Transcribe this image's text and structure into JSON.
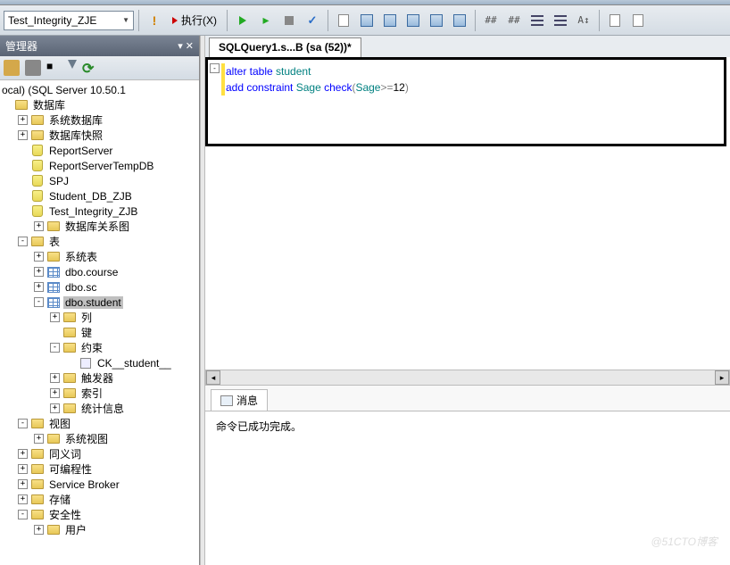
{
  "toolbar": {
    "db_selected": "Test_Integrity_ZJE",
    "execute_label": "执行(X)"
  },
  "sidebar": {
    "title": "管理器",
    "server": "ocal) (SQL Server 10.50.1",
    "nodes": [
      {
        "ind": 0,
        "exp": "",
        "icon": "folder",
        "label": "数据库"
      },
      {
        "ind": 1,
        "exp": "+",
        "icon": "folder",
        "label": "系统数据库"
      },
      {
        "ind": 1,
        "exp": "+",
        "icon": "folder",
        "label": "数据库快照"
      },
      {
        "ind": 1,
        "exp": "",
        "icon": "db",
        "label": "ReportServer"
      },
      {
        "ind": 1,
        "exp": "",
        "icon": "db",
        "label": "ReportServerTempDB"
      },
      {
        "ind": 1,
        "exp": "",
        "icon": "db",
        "label": "SPJ"
      },
      {
        "ind": 1,
        "exp": "",
        "icon": "db",
        "label": "Student_DB_ZJB"
      },
      {
        "ind": 1,
        "exp": "",
        "icon": "db",
        "label": "Test_Integrity_ZJB"
      },
      {
        "ind": 2,
        "exp": "+",
        "icon": "folder",
        "label": "数据库关系图"
      },
      {
        "ind": 1,
        "exp": "-",
        "icon": "folder",
        "label": "表"
      },
      {
        "ind": 2,
        "exp": "+",
        "icon": "folder",
        "label": "系统表"
      },
      {
        "ind": 2,
        "exp": "+",
        "icon": "table",
        "label": "dbo.course"
      },
      {
        "ind": 2,
        "exp": "+",
        "icon": "table",
        "label": "dbo.sc"
      },
      {
        "ind": 2,
        "exp": "-",
        "icon": "table",
        "label": "dbo.student",
        "selected": true
      },
      {
        "ind": 3,
        "exp": "+",
        "icon": "folder",
        "label": "列"
      },
      {
        "ind": 3,
        "exp": "",
        "icon": "folder",
        "label": "键"
      },
      {
        "ind": 3,
        "exp": "-",
        "icon": "folder",
        "label": "约束"
      },
      {
        "ind": 4,
        "exp": "",
        "icon": "col",
        "label": "CK__student__"
      },
      {
        "ind": 3,
        "exp": "+",
        "icon": "folder",
        "label": "触发器"
      },
      {
        "ind": 3,
        "exp": "+",
        "icon": "folder",
        "label": "索引"
      },
      {
        "ind": 3,
        "exp": "+",
        "icon": "folder",
        "label": "统计信息"
      },
      {
        "ind": 1,
        "exp": "-",
        "icon": "folder",
        "label": "视图"
      },
      {
        "ind": 2,
        "exp": "+",
        "icon": "folder",
        "label": "系统视图"
      },
      {
        "ind": 1,
        "exp": "+",
        "icon": "folder",
        "label": "同义词"
      },
      {
        "ind": 1,
        "exp": "+",
        "icon": "folder",
        "label": "可编程性"
      },
      {
        "ind": 1,
        "exp": "+",
        "icon": "folder",
        "label": "Service Broker"
      },
      {
        "ind": 1,
        "exp": "+",
        "icon": "folder",
        "label": "存储"
      },
      {
        "ind": 1,
        "exp": "-",
        "icon": "folder",
        "label": "安全性"
      },
      {
        "ind": 2,
        "exp": "+",
        "icon": "folder",
        "label": "用户"
      }
    ]
  },
  "editor": {
    "tab_title": "SQLQuery1.s...B (sa (52))*",
    "code": {
      "line1": {
        "t1": "alter",
        "t2": " table ",
        "t3": "student"
      },
      "line2": {
        "t1": "add",
        "t2": " constraint ",
        "t3": "Sage ",
        "t4": "check",
        "t5": "(",
        "t6": "Sage",
        "t7": ">=",
        "t8": "12",
        "t9": ")"
      }
    }
  },
  "results": {
    "tab_label": "消息",
    "message": "命令已成功完成。"
  },
  "watermark": "@51CTO博客"
}
